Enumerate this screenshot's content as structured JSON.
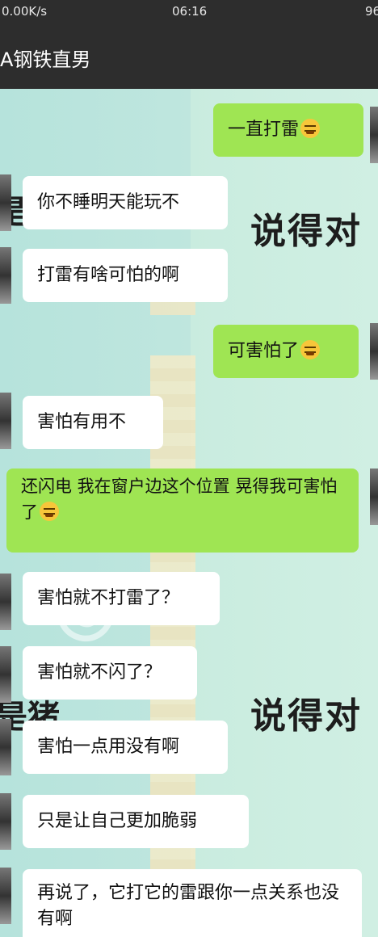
{
  "status_bar": {
    "speed": "0.00K/s",
    "time": "06:16",
    "battery": "96"
  },
  "header": {
    "title": "A钢铁直男"
  },
  "background": {
    "sticker_text_right": "说得对",
    "sticker_text_left": "是猪"
  },
  "messages": [
    {
      "side": "out",
      "text": "一直打雷",
      "emoji": "angry-face-icon"
    },
    {
      "side": "in",
      "text": "你不睡明天能玩不"
    },
    {
      "side": "in",
      "text": "打雷有啥可怕的啊"
    },
    {
      "side": "out",
      "text": "可害怕了",
      "emoji": "angry-face-icon"
    },
    {
      "side": "in",
      "text": "害怕有用不"
    },
    {
      "side": "out",
      "text": "还闪电  我在窗户边这个位置 晃得我可害怕了",
      "emoji": "angry-face-icon"
    },
    {
      "side": "in",
      "text": "害怕就不打雷了？"
    },
    {
      "side": "in",
      "text": "害怕就不闪了？"
    },
    {
      "side": "in",
      "text": "害怕一点用没有啊"
    },
    {
      "side": "in",
      "text": "只是让自己更加脆弱"
    },
    {
      "side": "in",
      "text": "再说了，它打它的雷跟你一点关系也没有啊"
    }
  ]
}
